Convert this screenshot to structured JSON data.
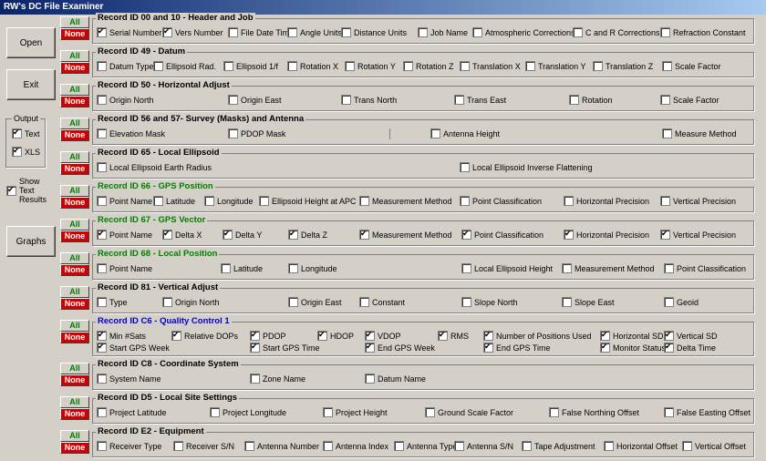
{
  "window": {
    "title": "RW's DC File Examiner"
  },
  "buttons": {
    "open": "Open",
    "exit": "Exit",
    "graphs": "Graphs"
  },
  "output": {
    "caption": "Output",
    "text": {
      "label": "Text",
      "checked": true
    },
    "xls": {
      "label": "XLS",
      "checked": true
    }
  },
  "show_text_results": {
    "label_line1": "Show",
    "label_line2": "Text",
    "label_line3": "Results",
    "checked": true
  },
  "all_label": "All",
  "none_label": "None",
  "groups": [
    {
      "title": "Record ID 00 and 10 - Header and Job",
      "color": "blk",
      "fields": [
        {
          "label": "Serial Number",
          "checked": true
        },
        {
          "label": "Vers Number",
          "checked": true
        },
        {
          "label": "File Date Time",
          "checked": false
        },
        {
          "label": "Angle Units",
          "checked": false
        },
        {
          "label": "Distance Units",
          "checked": false
        },
        {
          "label": "Job Name",
          "checked": false
        },
        {
          "label": "Atmospheric Corrections",
          "checked": false
        },
        {
          "label": "C and R Corrections",
          "checked": false
        },
        {
          "label": "Refraction Constant",
          "checked": false
        }
      ]
    },
    {
      "title": "Record ID 49 - Datum",
      "color": "blk",
      "fields": [
        {
          "label": "Datum Type",
          "checked": false
        },
        {
          "label": "Ellipsoid Rad.",
          "checked": false
        },
        {
          "label": "Ellipsoid 1/f",
          "checked": false
        },
        {
          "label": "Rotation X",
          "checked": false
        },
        {
          "label": "Rotation Y",
          "checked": false
        },
        {
          "label": "Rotation Z",
          "checked": false
        },
        {
          "label": "Translation X",
          "checked": false
        },
        {
          "label": "Translation Y",
          "checked": false
        },
        {
          "label": "Translation Z",
          "checked": false
        },
        {
          "label": "Scale Factor",
          "checked": false
        }
      ]
    },
    {
      "title": "Record ID 50 - Horizontal Adjust",
      "color": "blk",
      "fields": [
        {
          "label": "Origin North",
          "checked": false
        },
        {
          "label": "Origin East",
          "checked": false
        },
        {
          "label": "Trans North",
          "checked": false
        },
        {
          "label": "Trans East",
          "checked": false
        },
        {
          "label": "Rotation",
          "checked": false
        },
        {
          "label": "Scale Factor",
          "checked": false
        }
      ]
    },
    {
      "title": "Record ID 56 and 57- Survey (Masks) and Antenna",
      "color": "blk",
      "fields": [
        {
          "label": "Elevation Mask",
          "checked": false
        },
        {
          "label": "PDOP Mask",
          "checked": false
        },
        {
          "label": "Antenna Height",
          "checked": false
        },
        {
          "label": "Measure Method",
          "checked": false
        }
      ]
    },
    {
      "title": "Record ID 65 - Local Ellipsoid",
      "color": "blk",
      "fields": [
        {
          "label": "Local Ellipsoid Earth Radius",
          "checked": false
        },
        {
          "label": "Local Ellipsoid Inverse Flattening",
          "checked": false
        }
      ]
    },
    {
      "title": "Record ID 66 - GPS Position",
      "color": "grn",
      "fields": [
        {
          "label": "Point Name",
          "checked": false
        },
        {
          "label": "Latitude",
          "checked": false
        },
        {
          "label": "Longitude",
          "checked": false
        },
        {
          "label": "Ellipsoid Height at APC",
          "checked": false
        },
        {
          "label": "Measurement Method",
          "checked": false
        },
        {
          "label": "Point Classification",
          "checked": false
        },
        {
          "label": "Horizontal Precision",
          "checked": false
        },
        {
          "label": "Vertical Precision",
          "checked": false
        }
      ]
    },
    {
      "title": "Record ID 67 - GPS Vector",
      "color": "grn",
      "fields": [
        {
          "label": "Point Name",
          "checked": true
        },
        {
          "label": "Delta X",
          "checked": true
        },
        {
          "label": "Delta Y",
          "checked": true
        },
        {
          "label": "Delta Z",
          "checked": true
        },
        {
          "label": "Measurement Method",
          "checked": true
        },
        {
          "label": "Point Classification",
          "checked": true
        },
        {
          "label": "Horizontal Precision",
          "checked": true
        },
        {
          "label": "Vertical Precision",
          "checked": true
        }
      ]
    },
    {
      "title": "Record ID 68 - Local Position",
      "color": "grn",
      "fields": [
        {
          "label": "Point Name",
          "checked": false
        },
        {
          "label": "Latitude",
          "checked": false
        },
        {
          "label": "Longitude",
          "checked": false
        },
        {
          "label": "Local Ellipsoid Height",
          "checked": false
        },
        {
          "label": "Measurement Method",
          "checked": false
        },
        {
          "label": "Point Classification",
          "checked": false
        }
      ]
    },
    {
      "title": "Record ID 81 - Vertical Adjust",
      "color": "blk",
      "fields": [
        {
          "label": "Type",
          "checked": false
        },
        {
          "label": "Origin North",
          "checked": false
        },
        {
          "label": "Origin East",
          "checked": false
        },
        {
          "label": "Constant",
          "checked": false
        },
        {
          "label": "Slope North",
          "checked": false
        },
        {
          "label": "Slope East",
          "checked": false
        },
        {
          "label": "Geoid",
          "checked": false
        }
      ]
    },
    {
      "title": "Record ID C6 - Quality Control 1",
      "color": "blu",
      "fields": [
        {
          "label": "Min #Sats",
          "checked": true
        },
        {
          "label": "Relative DOPs",
          "checked": true
        },
        {
          "label": "PDOP",
          "checked": true
        },
        {
          "label": "HDOP",
          "checked": true
        },
        {
          "label": "VDOP",
          "checked": true
        },
        {
          "label": "RMS",
          "checked": true
        },
        {
          "label": "Number of Positions Used",
          "checked": true
        },
        {
          "label": "Horizontal SD",
          "checked": true
        },
        {
          "label": "Vertical SD",
          "checked": true
        },
        {
          "label": "Start GPS Week",
          "checked": true
        },
        {
          "label": "Start GPS Time",
          "checked": true
        },
        {
          "label": "End GPS Week",
          "checked": true
        },
        {
          "label": "End GPS Time",
          "checked": true
        },
        {
          "label": "Monitor Status",
          "checked": true
        },
        {
          "label": "Delta Time",
          "checked": true
        }
      ]
    },
    {
      "title": "Record ID C8 - Coordinate System",
      "color": "blk",
      "fields": [
        {
          "label": "System Name",
          "checked": false
        },
        {
          "label": "Zone Name",
          "checked": false
        },
        {
          "label": "Datum Name",
          "checked": false
        }
      ]
    },
    {
      "title": "Record ID D5 - Local Site Settings",
      "color": "blk",
      "fields": [
        {
          "label": "Project Latitude",
          "checked": false
        },
        {
          "label": "Project Longitude",
          "checked": false
        },
        {
          "label": "Project Height",
          "checked": false
        },
        {
          "label": "Ground Scale Factor",
          "checked": false
        },
        {
          "label": "False Northing Offset",
          "checked": false
        },
        {
          "label": "False Easting Offset",
          "checked": false
        }
      ]
    },
    {
      "title": "Record ID E2 - Equipment",
      "color": "blk",
      "fields": [
        {
          "label": "Receiver Type",
          "checked": false
        },
        {
          "label": "Receiver S/N",
          "checked": false
        },
        {
          "label": "Antenna Number",
          "checked": false
        },
        {
          "label": "Antenna Index",
          "checked": false
        },
        {
          "label": "Antenna Type",
          "checked": false
        },
        {
          "label": "Antenna S/N",
          "checked": false
        },
        {
          "label": "Tape Adjustment",
          "checked": false
        },
        {
          "label": "Horizontal Offset",
          "checked": false
        },
        {
          "label": "Vertical Offset",
          "checked": false
        }
      ]
    }
  ]
}
